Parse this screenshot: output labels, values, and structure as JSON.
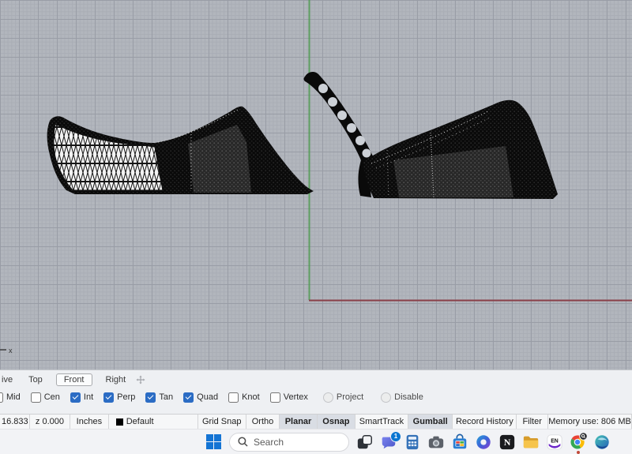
{
  "app": "Rhino 3D modeling viewport (Front view)",
  "viewport": {
    "axis_label_x": "x",
    "objects": [
      {
        "name": "wedge-heel-mesh-left"
      },
      {
        "name": "wedge-heel-mesh-right-with-perforated-strap"
      }
    ],
    "colors": {
      "background": "#b2b6bd",
      "grid_minor": "#a9adb5",
      "grid_major": "#999da6",
      "axis_green": "#4f9a52",
      "axis_red": "#8a4049",
      "mesh": "#0a0a0a"
    }
  },
  "viewport_tabs": {
    "items": [
      {
        "label": "ive",
        "active": false,
        "clipped": true
      },
      {
        "label": "Top",
        "active": false
      },
      {
        "label": "Front",
        "active": true
      },
      {
        "label": "Right",
        "active": false
      }
    ]
  },
  "osnap": {
    "items": [
      {
        "label": "Mid",
        "checked": false
      },
      {
        "label": "Cen",
        "checked": false
      },
      {
        "label": "Int",
        "checked": true
      },
      {
        "label": "Perp",
        "checked": true
      },
      {
        "label": "Tan",
        "checked": true
      },
      {
        "label": "Quad",
        "checked": true
      },
      {
        "label": "Knot",
        "checked": false
      },
      {
        "label": "Vertex",
        "checked": false
      },
      {
        "label": "Project",
        "checked": false,
        "style": "radio"
      },
      {
        "label": "Disable",
        "checked": false,
        "style": "radio"
      }
    ],
    "accent_color": "#2b6cc4"
  },
  "status_bar": {
    "coord_y": "16.833",
    "coord_z": "z 0.000",
    "units": "Inches",
    "layer": "Default",
    "layer_color": "#000000",
    "panes": [
      {
        "label": "Grid Snap",
        "active": false
      },
      {
        "label": "Ortho",
        "active": false
      },
      {
        "label": "Planar",
        "active": true
      },
      {
        "label": "Osnap",
        "active": true
      },
      {
        "label": "SmartTrack",
        "active": false
      },
      {
        "label": "Gumball",
        "active": true
      },
      {
        "label": "Record History",
        "active": false
      },
      {
        "label": "Filter",
        "active": false
      }
    ],
    "memory": "Memory use: 806 MB"
  },
  "taskbar": {
    "search_placeholder": "Search",
    "chat_badge": "1",
    "icons": [
      "start",
      "search",
      "task-view",
      "chat",
      "calculator",
      "camera",
      "store",
      "copilot",
      "notion",
      "file-explorer",
      "en-app",
      "chrome",
      "edge"
    ]
  }
}
